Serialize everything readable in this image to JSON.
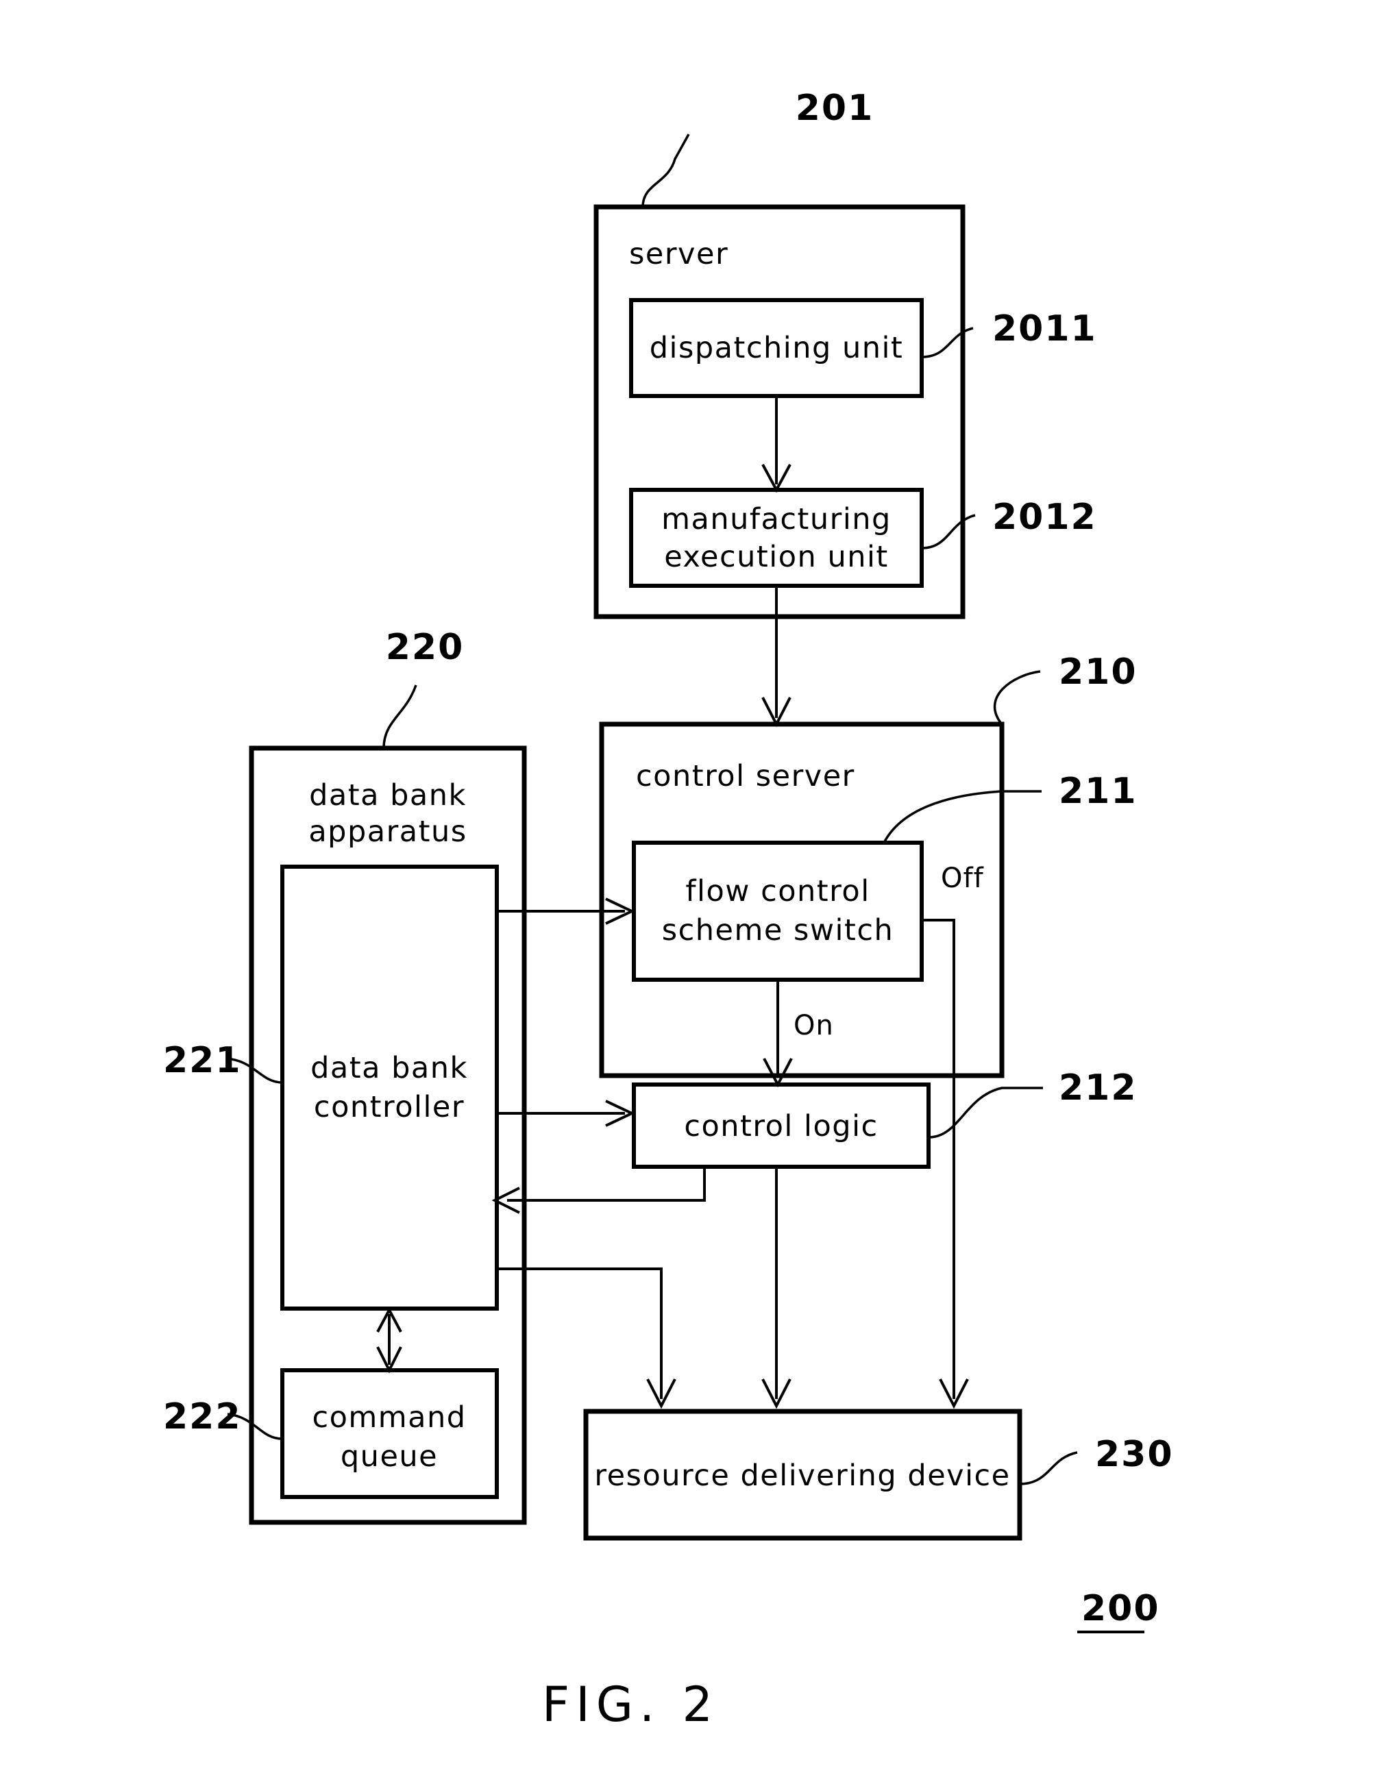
{
  "figure": {
    "caption": "FIG. 2",
    "system_ref": "200"
  },
  "blocks": {
    "server": {
      "title": "server",
      "ref": "201",
      "children": [
        {
          "label": "dispatching unit",
          "ref": "2011"
        },
        {
          "label": "manufacturing\nexecution unit",
          "ref": "2012",
          "line1": "manufacturing",
          "line2": "execution unit"
        }
      ]
    },
    "control_server": {
      "title": "control server",
      "ref": "210",
      "children": [
        {
          "label": "flow control scheme switch",
          "ref": "211",
          "line1": "flow control",
          "line2": "scheme switch"
        },
        {
          "label": "control logic",
          "ref": "212"
        }
      ]
    },
    "data_bank_apparatus": {
      "title": "data bank apparatus",
      "ref": "220",
      "title_line1": "data bank",
      "title_line2": "apparatus",
      "children": [
        {
          "label": "data bank controller",
          "ref": "221",
          "line1": "data bank",
          "line2": "controller"
        },
        {
          "label": "command queue",
          "ref": "222",
          "line1": "command",
          "line2": "queue"
        }
      ]
    },
    "resource_delivering_device": {
      "title": "resource delivering device",
      "ref": "230"
    }
  },
  "edge_labels": {
    "off": "Off",
    "on": "On"
  },
  "colors": {
    "stroke": "#000000",
    "background": "#ffffff"
  }
}
